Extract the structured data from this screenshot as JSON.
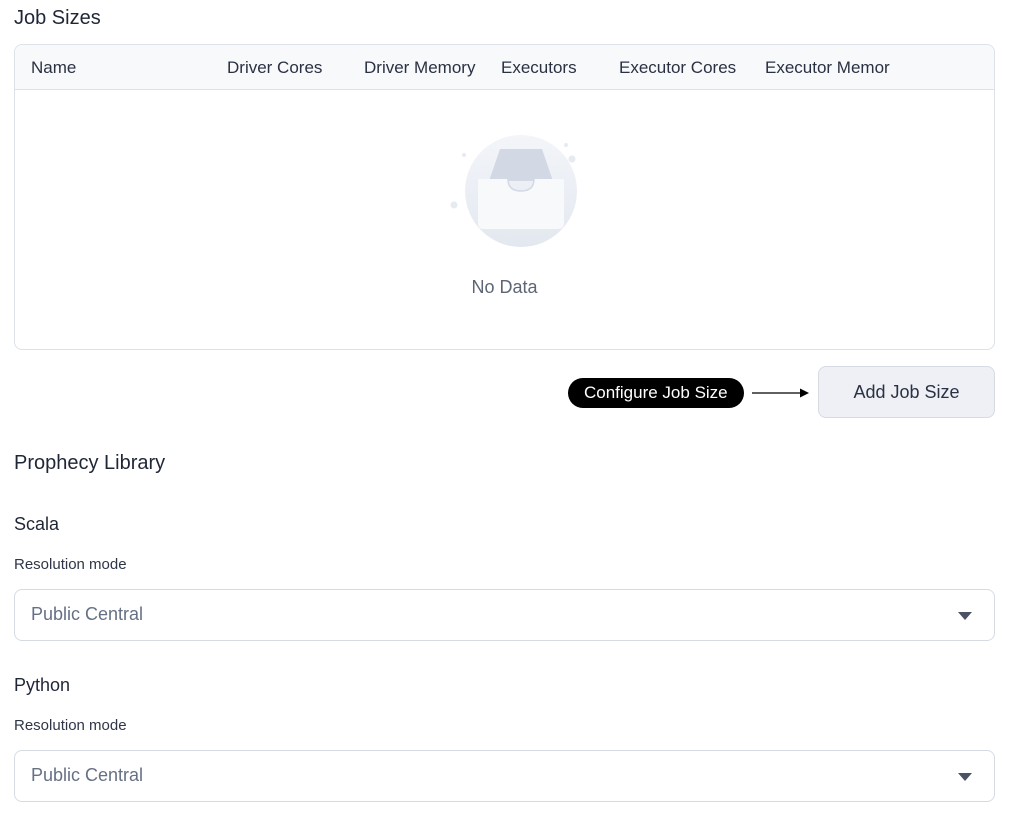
{
  "job_sizes": {
    "title": "Job Sizes",
    "columns": [
      "Name",
      "Driver Cores",
      "Driver Memory",
      "Executors",
      "Executor Cores",
      "Executor Memor"
    ],
    "rows": [],
    "empty_text": "No Data",
    "add_button_label": "Add Job Size",
    "callout_label": "Configure Job Size"
  },
  "prophecy_library": {
    "title": "Prophecy Library",
    "scala": {
      "title": "Scala",
      "field_label": "Resolution mode",
      "value": "Public Central"
    },
    "python": {
      "title": "Python",
      "field_label": "Resolution mode",
      "value": "Public Central"
    }
  },
  "icons": {
    "empty_state": "empty-inbox-icon",
    "dropdown": "chevron-down-icon"
  },
  "colors": {
    "callout_bg": "#000000",
    "button_bg": "#eef0f5",
    "border": "#dde1e8"
  }
}
